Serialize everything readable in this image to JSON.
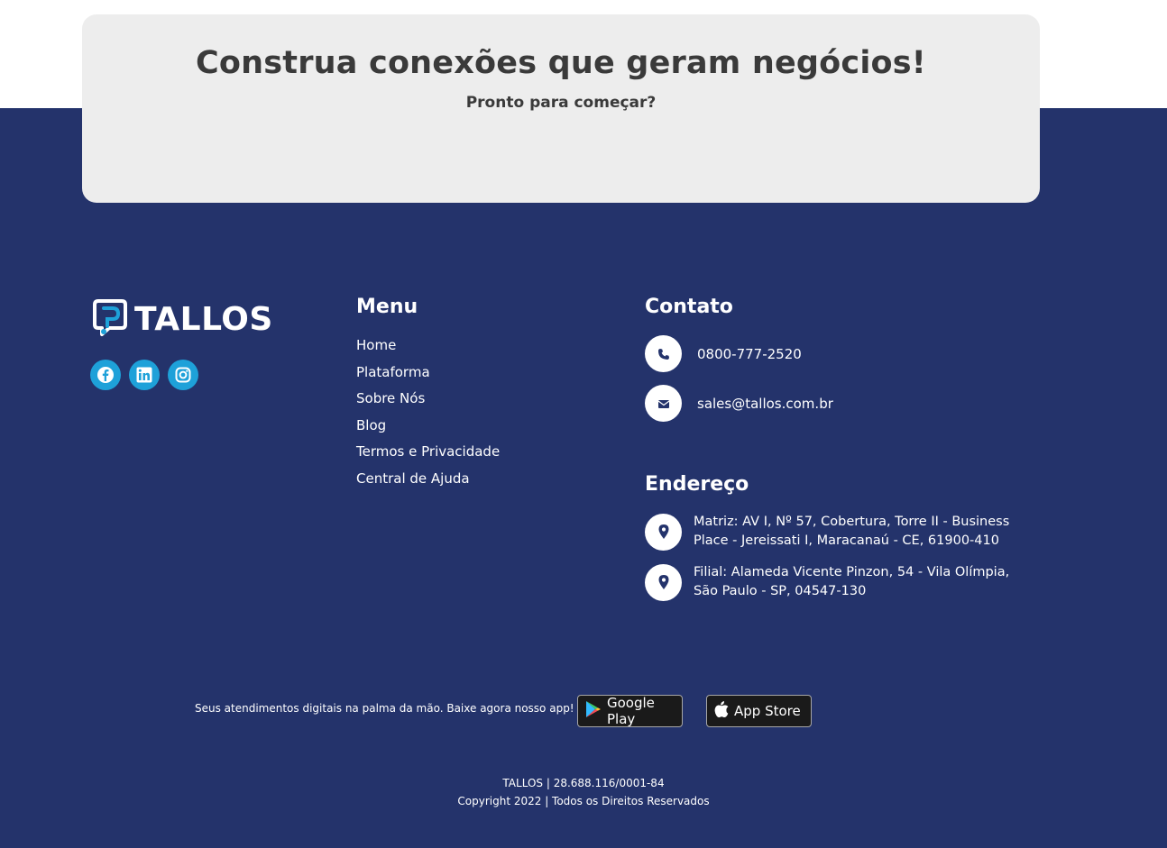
{
  "cta": {
    "title": "Construa conexões que geram negócios!",
    "subtitle": "Pronto para começar?"
  },
  "brand": {
    "name": "TALLOS",
    "accent": "#1ea1d9",
    "background": "#24336b"
  },
  "social": [
    {
      "name": "facebook-icon"
    },
    {
      "name": "linkedin-icon"
    },
    {
      "name": "instagram-icon"
    }
  ],
  "menu": {
    "title": "Menu",
    "items": [
      "Home",
      "Plataforma",
      "Sobre Nós",
      "Blog",
      "Termos e Privacidade",
      "Central de Ajuda"
    ]
  },
  "contact": {
    "title": "Contato",
    "phone": "0800-777-2520",
    "email": "sales@tallos.com.br"
  },
  "address": {
    "title": "Endereço",
    "matriz": "Matriz: AV I, Nº 57, Cobertura, Torre II - Business Place - Jereissati I, Maracanaú - CE, 61900-410",
    "filial": "Filial: Alameda Vicente Pinzon, 54 - Vila Olímpia, São Paulo - SP, 04547-130"
  },
  "app": {
    "text": "Seus atendimentos digitais na palma da mão. Baixe agora nosso app!",
    "google_play": "Google Play",
    "app_store": "App Store"
  },
  "footer": {
    "company": "TALLOS | 28.688.116/0001-84",
    "copyright": "Copyright 2022 | Todos os Direitos Reservados"
  }
}
